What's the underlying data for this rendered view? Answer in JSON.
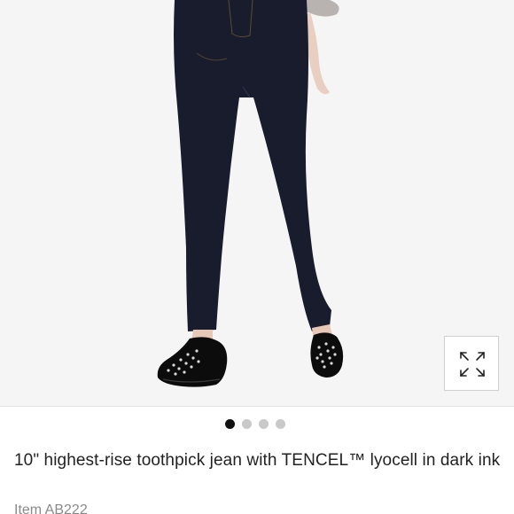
{
  "product": {
    "title": "10\" highest-rise toothpick jean with TENCEL™ lyocell in dark ink",
    "item_number": "Item AB222"
  },
  "gallery": {
    "image_count": 4,
    "active_index": 0,
    "expand_icon": "expand-arrows-icon"
  },
  "colors": {
    "denim": "#181c2c",
    "shoe": "#0c0c0c",
    "background": "#f5f5f5",
    "dot_active": "#111111",
    "dot_inactive": "#c9c9c9"
  }
}
